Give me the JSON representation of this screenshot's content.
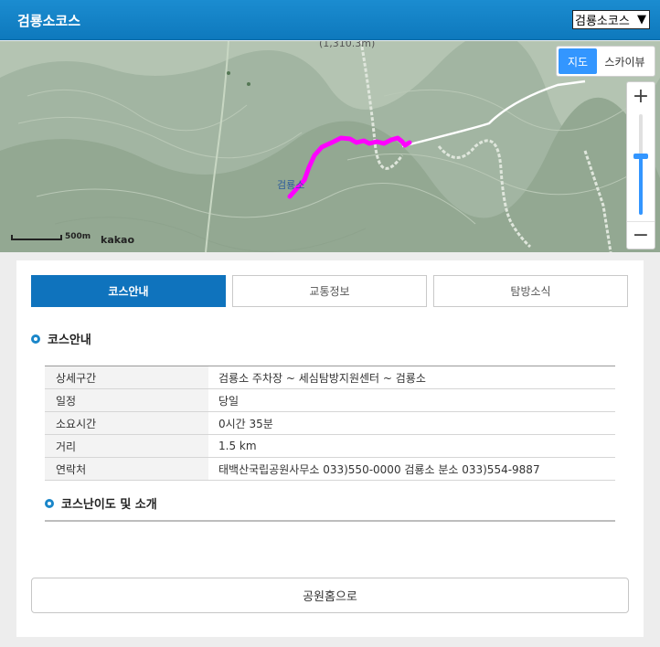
{
  "header": {
    "title": "검룡소코스",
    "course_select": {
      "selected": "검룡소코스"
    }
  },
  "map": {
    "peak_label": "(1,310.3m)",
    "place_label": "검룡소",
    "map_type": {
      "map": "지도",
      "skyview": "스카이뷰",
      "selected": "지도"
    },
    "zoom": {
      "plus": "+",
      "minus": "−"
    },
    "scale_label": "500m",
    "logo": "kakao",
    "route_color": "#ff00ff"
  },
  "tabs": [
    {
      "label": "코스안내",
      "active": true
    },
    {
      "label": "교통정보",
      "active": false
    },
    {
      "label": "탐방소식",
      "active": false
    }
  ],
  "course_info": {
    "title": "코스안내",
    "rows": [
      {
        "key": "상세구간",
        "value": "검룡소 주차장 ~ 세심탐방지원센터 ~ 검룡소"
      },
      {
        "key": "일정",
        "value": "당일"
      },
      {
        "key": "소요시간",
        "value": "0시간 35분"
      },
      {
        "key": "거리",
        "value": "1.5 km"
      },
      {
        "key": "연락처",
        "value": "태백산국립공원사무소 033)550-0000 검룡소 분소 033)554-9887"
      }
    ]
  },
  "difficulty": {
    "title": "코스난이도 및 소개"
  },
  "home_button": "공원홈으로",
  "colors": {
    "header": "#0f73bd",
    "active_tab": "#0f73bd",
    "map_type_active": "#3396ff",
    "bullet": "#1a86c9"
  }
}
